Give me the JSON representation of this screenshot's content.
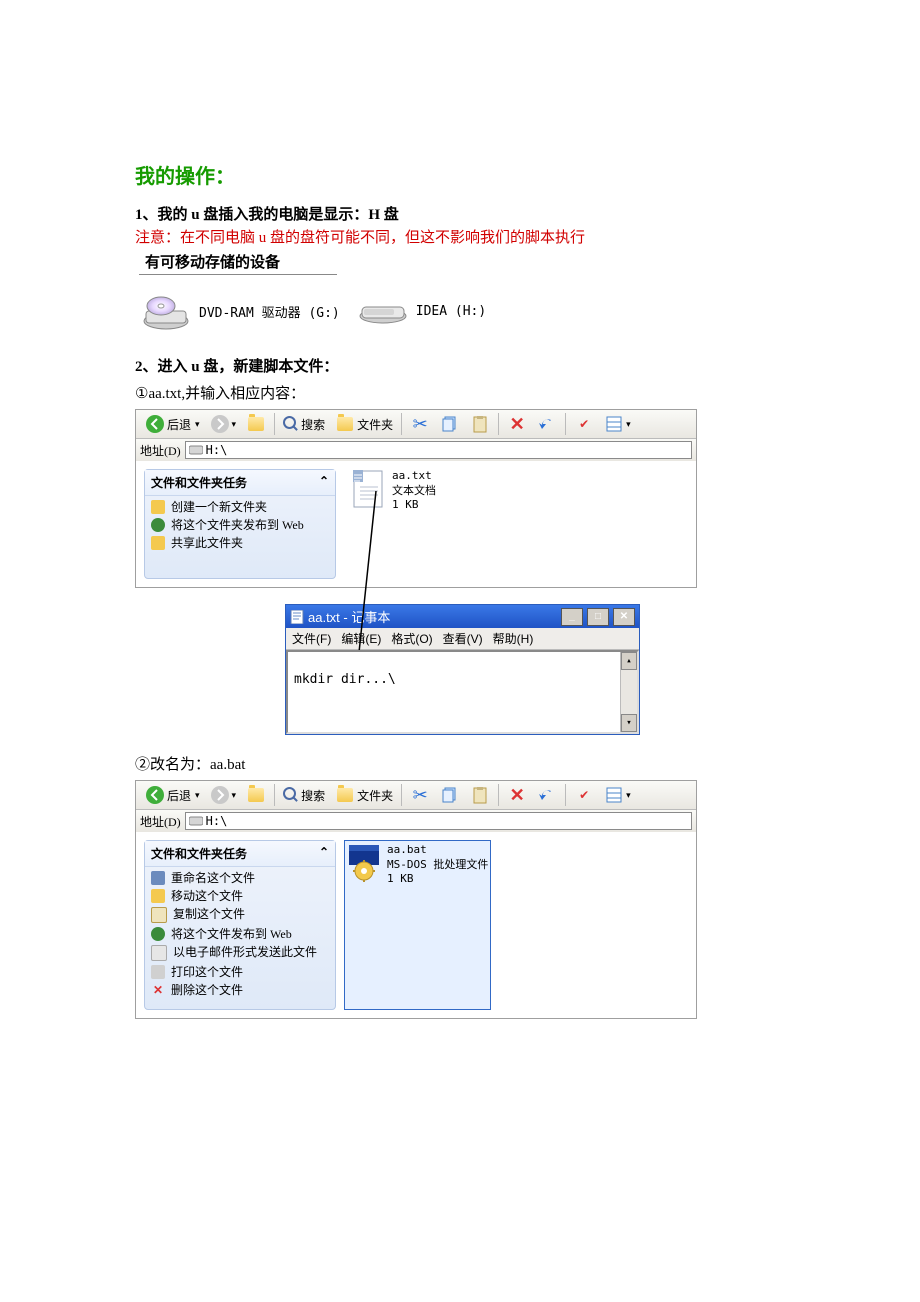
{
  "title": "我的操作：",
  "step1_heading": "1、我的 u 盘插入我的电脑是显示：H 盘",
  "step1_note": "注意：在不同电脑 u 盘的盘符可能不同，但这不影响我们的脚本执行",
  "removable_label": "有可移动存储的设备",
  "drive_g": "DVD-RAM 驱动器 (G:)",
  "drive_h": "IDEA (H:)",
  "step2_heading": "2、进入 u 盘，新建脚本文件：",
  "step2_sub": "①aa.txt,并输入相应内容：",
  "toolbar": {
    "back": "后退",
    "search": "搜索",
    "folders": "文件夹",
    "addr_label": "地址(D)",
    "addr_value": "H:\\"
  },
  "file_txt": {
    "name": "aa.txt",
    "type": "文本文档",
    "size": "1 KB"
  },
  "tasks1": {
    "title": "文件和文件夹任务",
    "items": [
      "创建一个新文件夹",
      "将这个文件夹发布到 Web",
      "共享此文件夹"
    ]
  },
  "notepad": {
    "title": "aa.txt - 记事本",
    "menus": [
      "文件(F)",
      "编辑(E)",
      "格式(O)",
      "查看(V)",
      "帮助(H)"
    ],
    "content": "mkdir dir...\\"
  },
  "step3_sub": "②改名为：aa.bat",
  "file_bat": {
    "name": "aa.bat",
    "type": "MS-DOS 批处理文件",
    "size": "1 KB"
  },
  "tasks2": {
    "title": "文件和文件夹任务",
    "items": [
      "重命名这个文件",
      "移动这个文件",
      "复制这个文件",
      "将这个文件发布到 Web",
      "以电子邮件形式发送此文件",
      "打印这个文件",
      "删除这个文件"
    ]
  }
}
